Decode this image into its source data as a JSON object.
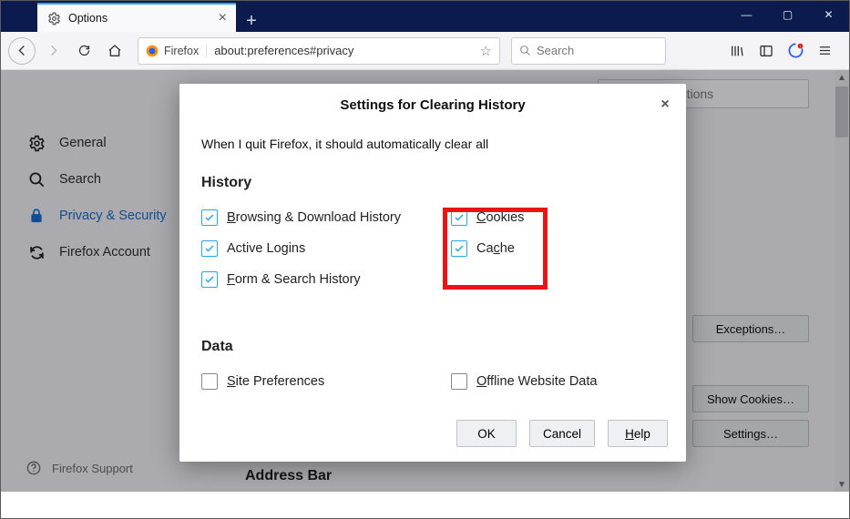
{
  "window": {
    "tab_title": "Options"
  },
  "window_controls": {
    "min": "—",
    "max": "▢",
    "close": "✕"
  },
  "navbar": {
    "identity_label": "Firefox",
    "url": "about:preferences#privacy",
    "search_placeholder": "Search"
  },
  "sidebar": {
    "items": [
      {
        "label": "General"
      },
      {
        "label": "Search"
      },
      {
        "label": "Privacy & Security"
      },
      {
        "label": "Firefox Account"
      }
    ],
    "support": "Firefox Support"
  },
  "page": {
    "find_placeholder": "Find in Options",
    "buttons": {
      "exceptions": "Exceptions…",
      "show_cookies": "Show Cookies…",
      "settings": "Settings…"
    },
    "address_bar_heading": "Address Bar"
  },
  "dialog": {
    "title": "Settings for Clearing History",
    "intro": "When I quit Firefox, it should automatically clear all",
    "sections": {
      "history": {
        "heading": "History",
        "left": [
          {
            "label_pre": "B",
            "label_rest": "rowsing & Download History",
            "checked": true
          },
          {
            "label_pre": "",
            "label_rest": "Active Logins",
            "checked": true
          },
          {
            "label_pre": "F",
            "label_rest": "orm & Search History",
            "checked": true
          }
        ],
        "right": [
          {
            "label_pre": "C",
            "label_rest": "ookies",
            "checked": true
          },
          {
            "label_pre": "",
            "label_rest": "Ca",
            "label_u": "c",
            "label_rest2": "he",
            "checked": true
          }
        ]
      },
      "data": {
        "heading": "Data",
        "left": [
          {
            "label_pre": "S",
            "label_rest": "ite Preferences",
            "checked": false
          }
        ],
        "right": [
          {
            "label_pre": "O",
            "label_rest": "ffline Website Data",
            "checked": false
          }
        ]
      }
    },
    "buttons": {
      "ok": "OK",
      "cancel": "Cancel",
      "help_pre": "H",
      "help_rest": "elp"
    }
  }
}
